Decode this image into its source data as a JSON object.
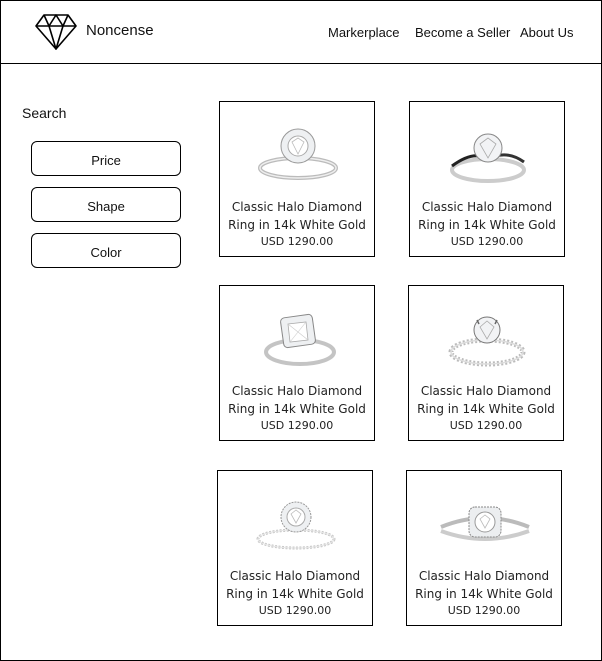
{
  "header": {
    "brand": "Noncense",
    "logo_icon": "diamond-icon",
    "nav": [
      "Markerplace",
      "Become a Seller",
      "About Us"
    ]
  },
  "sidebar": {
    "search_label": "Search",
    "filters": [
      "Price",
      "Shape",
      "Color"
    ]
  },
  "products": [
    {
      "title_line1": "Classic Halo Diamond",
      "title_line2": "Ring in 14k White Gold",
      "price": "USD 1290.00",
      "image": "ring-image"
    },
    {
      "title_line1": "Classic Halo Diamond",
      "title_line2": "Ring in 14k White Gold",
      "price": "USD 1290.00",
      "image": "ring-image"
    },
    {
      "title_line1": "Classic Halo Diamond",
      "title_line2": "Ring in 14k White Gold",
      "price": "USD 1290.00",
      "image": "ring-image"
    },
    {
      "title_line1": "Classic Halo Diamond",
      "title_line2": "Ring in 14k White Gold",
      "price": "USD 1290.00",
      "image": "ring-image"
    },
    {
      "title_line1": "Classic Halo Diamond",
      "title_line2": "Ring in 14k White Gold",
      "price": "USD 1290.00",
      "image": "ring-image"
    },
    {
      "title_line1": "Classic Halo Diamond",
      "title_line2": "Ring in 14k White Gold",
      "price": "USD 1290.00",
      "image": "ring-image"
    }
  ]
}
